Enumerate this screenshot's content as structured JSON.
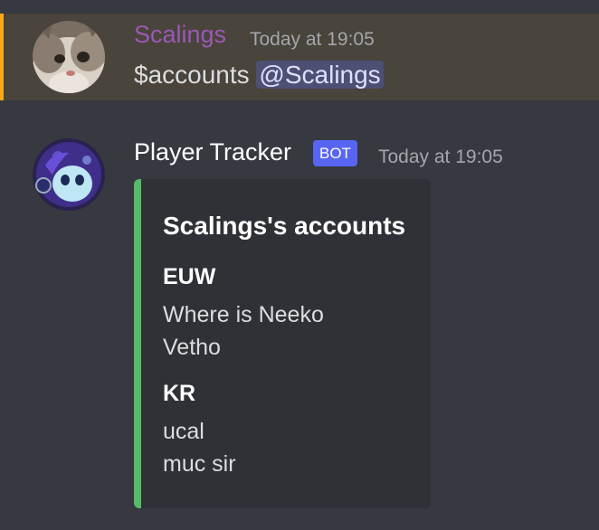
{
  "messages": {
    "user_message": {
      "username": "Scalings",
      "timestamp": "Today at 19:05",
      "command": "$accounts",
      "mention": "@Scalings",
      "avatar_icon": "cat-avatar-icon",
      "name_color": "#9b59b6",
      "highlight_color": "#faa81a"
    },
    "bot_message": {
      "username": "Player Tracker",
      "bot_tag": "BOT",
      "timestamp": "Today at 19:05",
      "avatar_icon": "neeko-avatar-icon",
      "embed": {
        "accent_color": "#58b968",
        "title": "Scalings's accounts",
        "fields": [
          {
            "name": "EUW",
            "values": [
              "Where is Neeko",
              "Vetho"
            ]
          },
          {
            "name": "KR",
            "values": [
              "ucal",
              "muc sir"
            ]
          }
        ]
      }
    }
  }
}
